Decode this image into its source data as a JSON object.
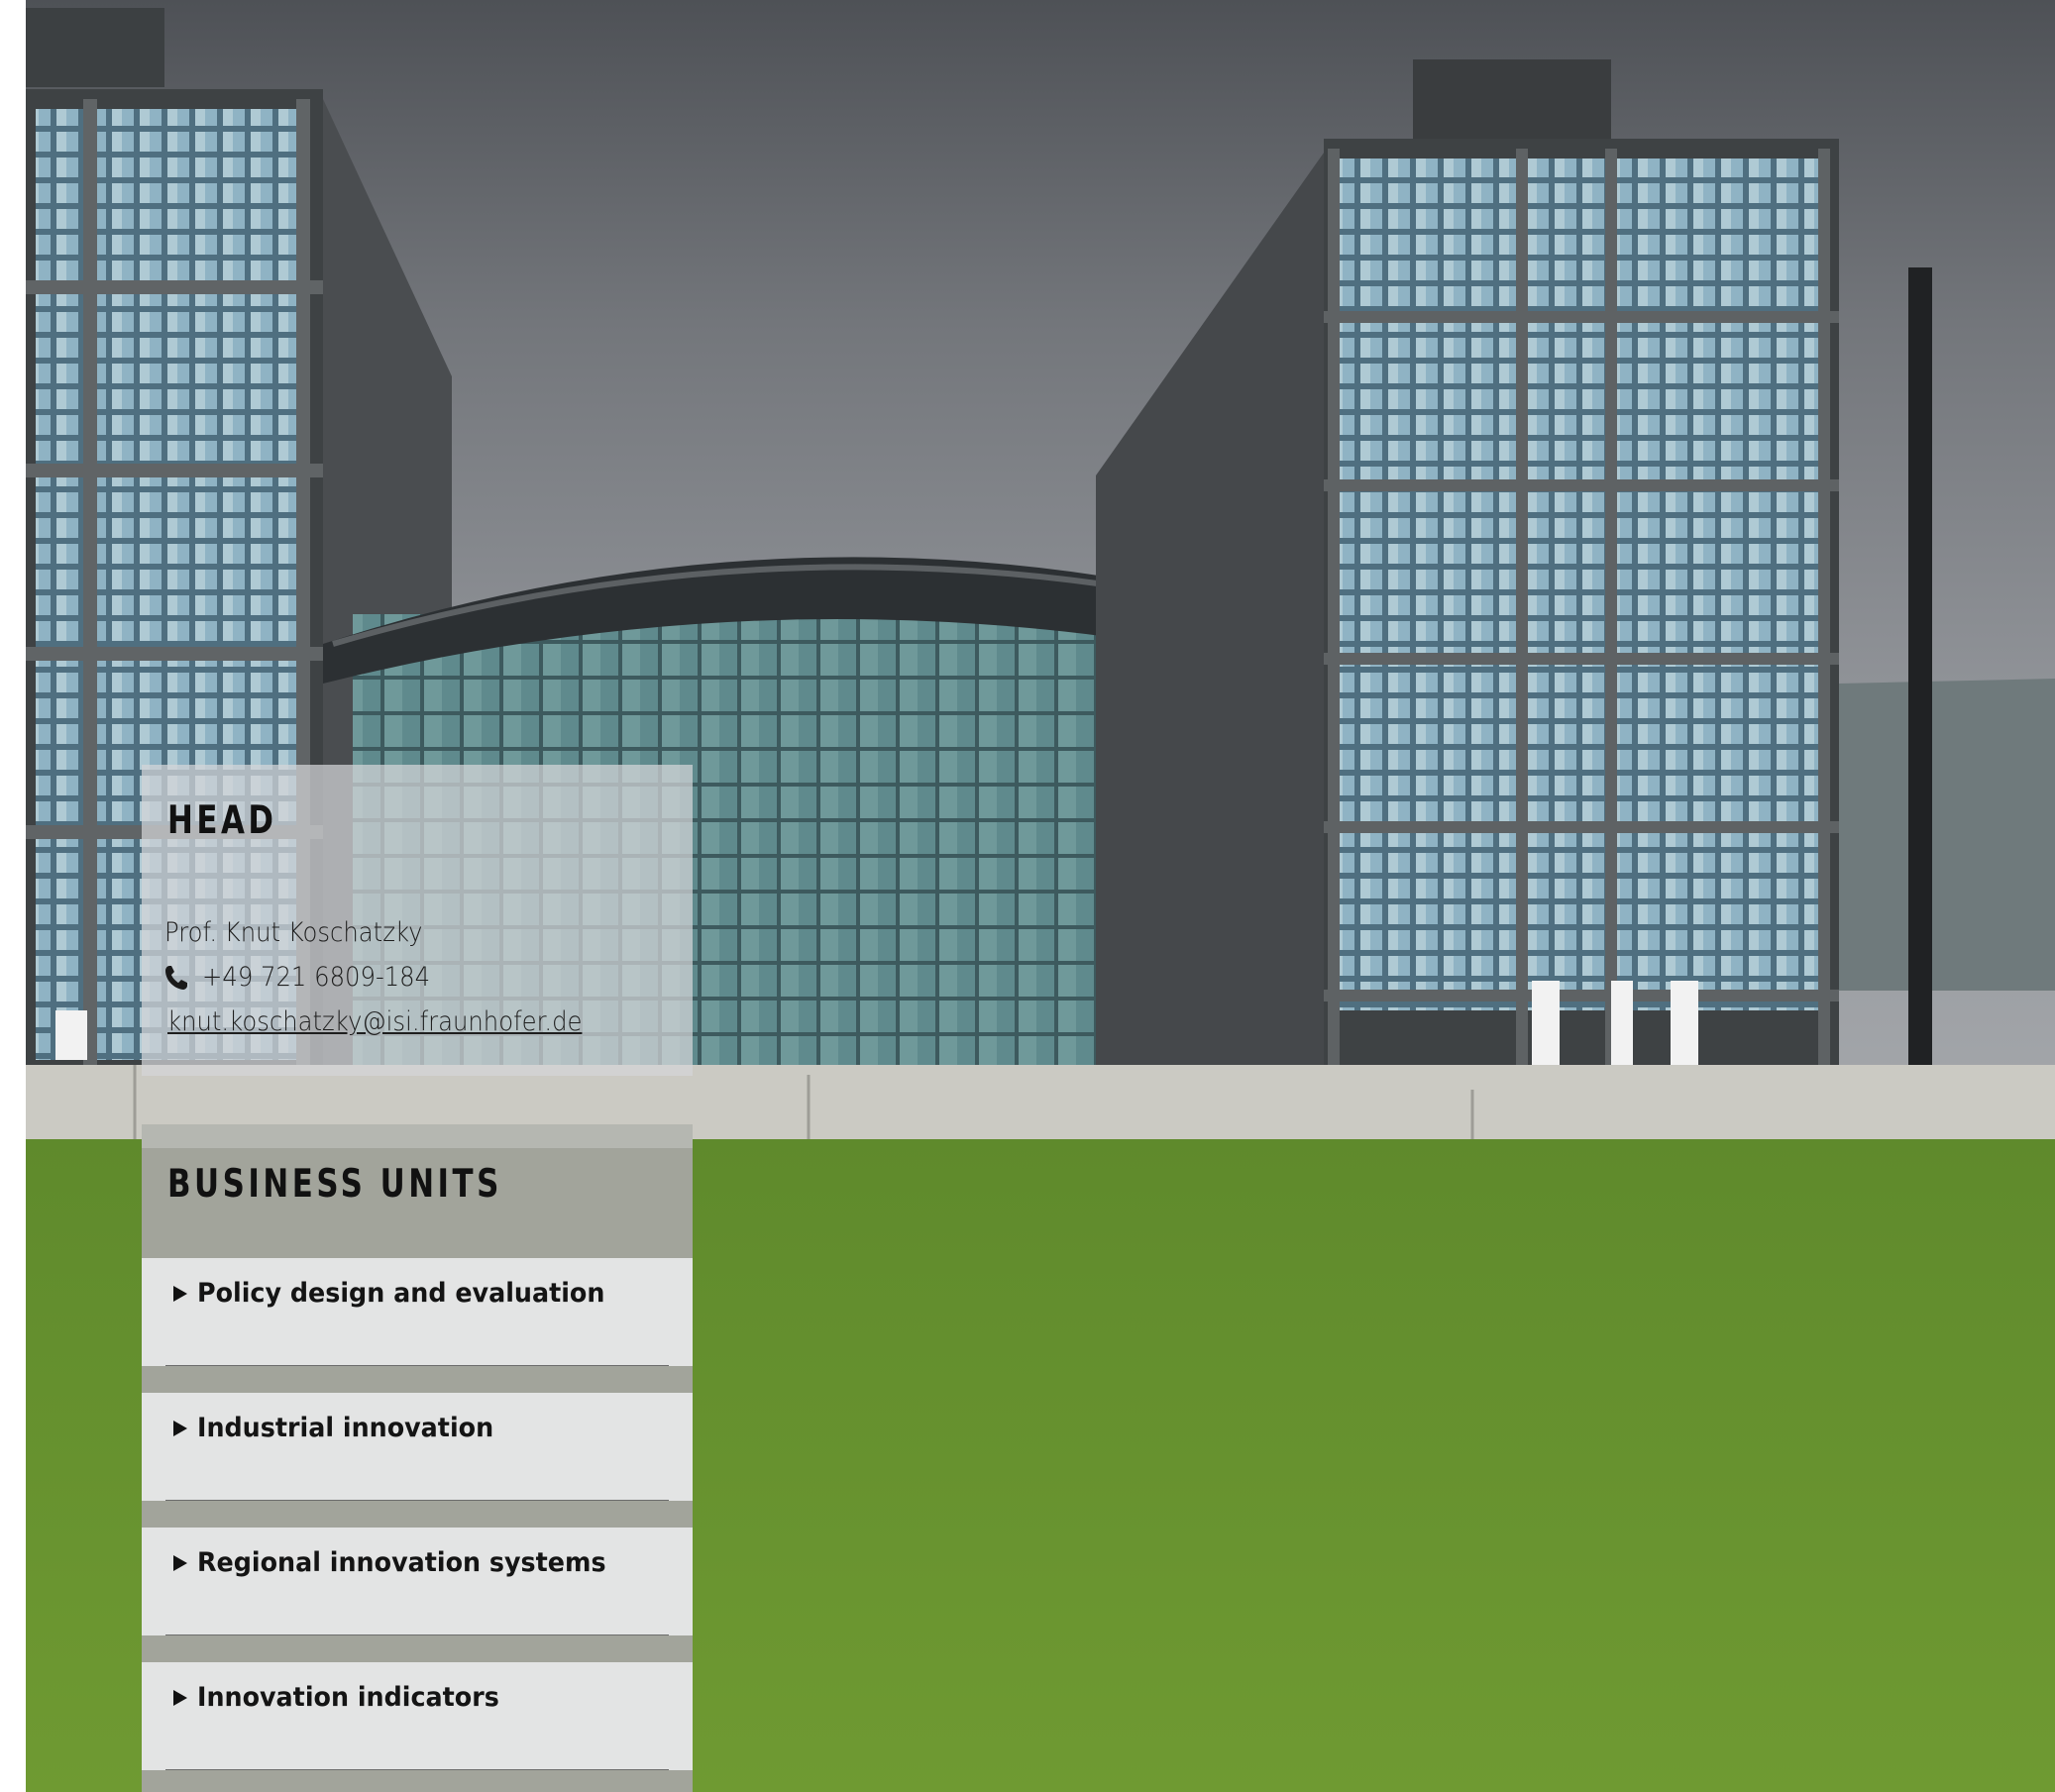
{
  "head": {
    "title": "HEAD",
    "name": "Prof. Knut Koschatzky",
    "phone": "+49 721 6809-184",
    "email": "knut.koschatzky@isi.fraunhofer.de"
  },
  "business_units": {
    "title": "BUSINESS UNITS",
    "items": [
      {
        "label": "Policy design and evaluation"
      },
      {
        "label": "Industrial innovation"
      },
      {
        "label": "Regional innovation systems"
      },
      {
        "label": "Innovation indicators"
      }
    ]
  },
  "icons": {
    "phone": "phone-icon",
    "expand": "triangle-right-icon"
  }
}
